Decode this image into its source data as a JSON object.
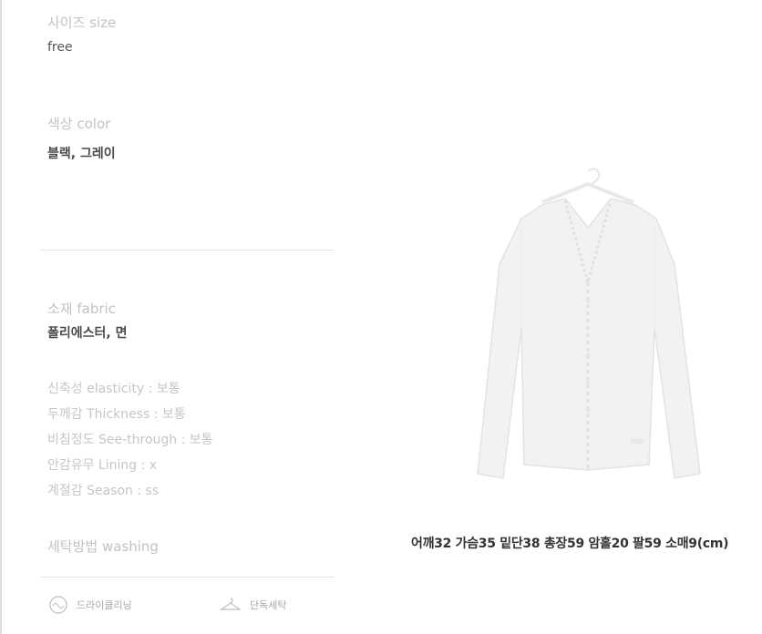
{
  "size": {
    "label": "사이즈  size",
    "value": "free"
  },
  "color": {
    "label": "색상  color",
    "value": "블랙, 그레이"
  },
  "fabric": {
    "label": "소재  fabric",
    "value": "폴리에스터, 면"
  },
  "properties": [
    "신축성 elasticity : 보통",
    "두께감 Thickness : 보통",
    "비침정도 See-through : 보통",
    "안감유무 Lining : x",
    "계절감 Season : ss"
  ],
  "washing": {
    "label": "세탁방법  washing",
    "options": [
      {
        "icon": "dry-cleaning-icon",
        "label": "드라이클리닝"
      },
      {
        "icon": "hanger-icon",
        "label": "단독세탁"
      }
    ]
  },
  "product_image": {
    "icon": "cardigan-on-hanger-icon"
  },
  "measurements": "어깨32  가슴35  밑단38  총장59  암홀20  팔59  소매9(cm)"
}
